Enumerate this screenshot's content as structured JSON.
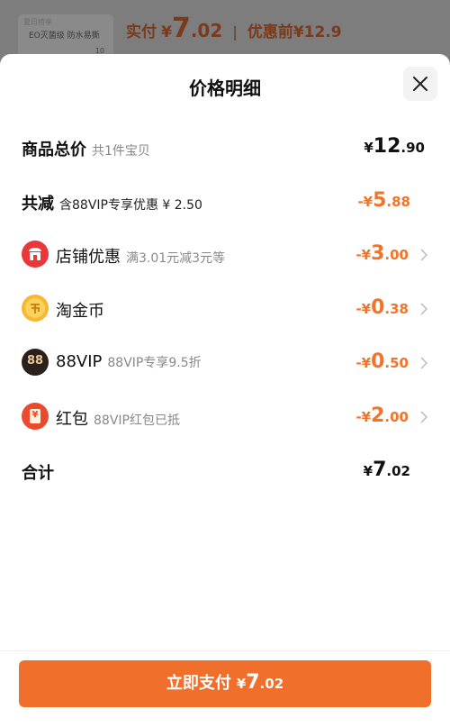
{
  "background": {
    "thumb_tag": "夏日特享",
    "thumb_text": "EO灭菌级 防水易撕",
    "thumb_num": "10",
    "pay_label": "实付",
    "pay_symbol": "¥",
    "pay_int": "7",
    "pay_dec": ".02",
    "separator": "|",
    "before_label": "优惠前",
    "before_amount": "¥12.9"
  },
  "sheet": {
    "title": "价格明细",
    "close_icon": "close-icon"
  },
  "rows": {
    "total": {
      "label": "商品总价",
      "sub": "共1件宝贝",
      "yen": "¥",
      "int": "12",
      "dec": ".90"
    },
    "reduce": {
      "label": "共减",
      "sub": "含88VIP专享优惠 ¥ 2.50",
      "yen": "-¥",
      "int": "5",
      "dec": ".88"
    },
    "shop": {
      "icon": "shop-icon",
      "label": "店铺优惠",
      "sub": "满3.01元减3元等",
      "yen": "-¥",
      "int": "3",
      "dec": ".00"
    },
    "coin": {
      "icon": "gold-coin-icon",
      "label": "淘金币",
      "sub": "",
      "yen": "-¥",
      "int": "0",
      "dec": ".38"
    },
    "vip": {
      "icon": "vip88-icon",
      "icon_text": "88",
      "label": "88VIP",
      "sub": "88VIP专享9.5折",
      "yen": "-¥",
      "int": "0",
      "dec": ".50"
    },
    "redpack": {
      "icon": "red-packet-icon",
      "icon_text": "¥",
      "label": "红包",
      "sub": "88VIP红包已抵",
      "yen": "-¥",
      "int": "2",
      "dec": ".00"
    },
    "sum": {
      "label": "合计",
      "yen": "¥",
      "int": "7",
      "dec": ".02"
    }
  },
  "footer": {
    "pay_label": "立即支付",
    "yen": "¥",
    "int": "7",
    "dec": ".02"
  },
  "colors": {
    "accent": "#f0702b",
    "discount": "#f0742a"
  }
}
